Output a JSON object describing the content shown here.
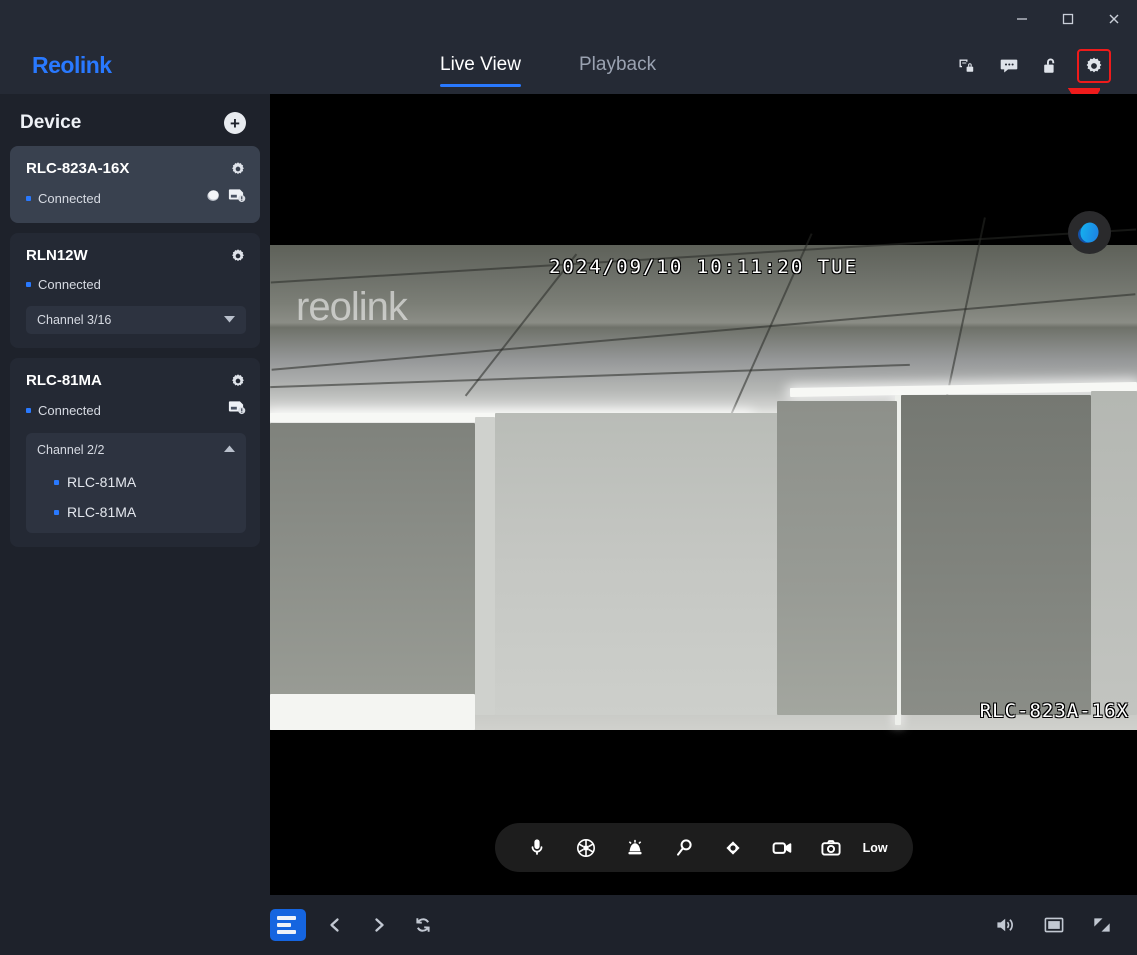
{
  "window": {
    "minimize_label": "minimize",
    "maximize_label": "maximize",
    "close_label": "close"
  },
  "header": {
    "logo": "Reolink",
    "tabs": [
      {
        "label": "Live View",
        "active": true
      },
      {
        "label": "Playback",
        "active": false
      }
    ],
    "icons": [
      {
        "name": "screen-lock-icon",
        "highlighted": false
      },
      {
        "name": "message-icon",
        "highlighted": false
      },
      {
        "name": "unlock-icon",
        "highlighted": false
      },
      {
        "name": "settings-gear-icon",
        "highlighted": true
      }
    ],
    "accent_color": "#2979ff",
    "highlight_color": "#ef1b1b"
  },
  "sidebar": {
    "title": "Device",
    "add_button_label": "+",
    "devices": [
      {
        "name": "RLC-823A-16X",
        "status": "Connected",
        "selected": true,
        "channel": null,
        "channel_expanded": false,
        "channels": []
      },
      {
        "name": "RLN12W",
        "status": "Connected",
        "selected": false,
        "channel": "Channel 3/16",
        "channel_expanded": false,
        "channels": []
      },
      {
        "name": "RLC-81MA",
        "status": "Connected",
        "selected": false,
        "channel": "Channel 2/2",
        "channel_expanded": true,
        "channels": [
          "RLC-81MA",
          "RLC-81MA"
        ]
      }
    ]
  },
  "video": {
    "osd_timestamp": "2024/09/10 10:11:20 TUE",
    "osd_camera_name": "RLC-823A-16X",
    "watermark": "reolink",
    "toolbar": [
      {
        "name": "microphone-icon",
        "label": ""
      },
      {
        "name": "color-wheel-icon",
        "label": ""
      },
      {
        "name": "siren-alarm-icon",
        "label": ""
      },
      {
        "name": "zoom-magnifier-icon",
        "label": ""
      },
      {
        "name": "ptz-control-icon",
        "label": ""
      },
      {
        "name": "record-video-icon",
        "label": ""
      },
      {
        "name": "snapshot-camera-icon",
        "label": ""
      }
    ],
    "quality_label": "Low"
  },
  "bottombar": {
    "layout_button": "layout-button",
    "prev_label": "previous",
    "next_label": "next",
    "refresh_label": "refresh",
    "volume_label": "volume",
    "aspect_label": "aspect-ratio",
    "fullscreen_label": "fullscreen"
  }
}
